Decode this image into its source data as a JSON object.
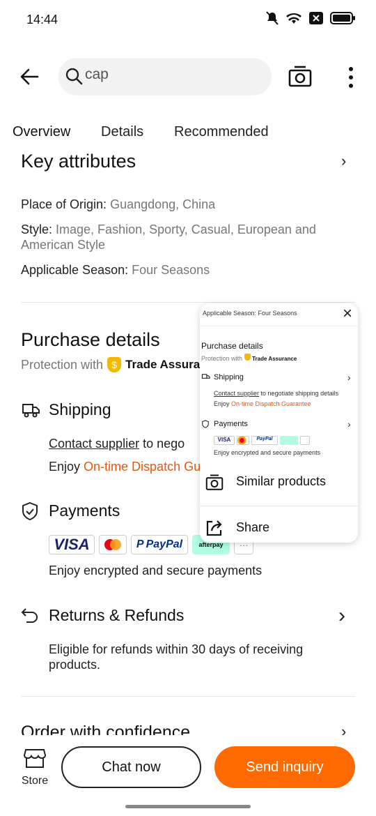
{
  "status": {
    "time": "14:44"
  },
  "search": {
    "value": "cap"
  },
  "tabs": [
    "Overview",
    "Details",
    "Recommended"
  ],
  "key_attributes": {
    "title": "Key attributes",
    "items": [
      {
        "label": "Place of Origin: ",
        "value": "Guangdong, China"
      },
      {
        "label": "Style: ",
        "value": "Image, Fashion, Sporty, Casual, European and American Style"
      },
      {
        "label": "Applicable Season: ",
        "value": "Four Seasons"
      }
    ]
  },
  "purchase": {
    "title": "Purchase details",
    "protection_prefix": "Protection with",
    "trade_assurance": "Trade Assuran"
  },
  "shipping": {
    "title": "Shipping",
    "contact_link": "Contact supplier",
    "contact_rest": " to nego",
    "enjoy_prefix": "Enjoy ",
    "dispatch": "On-time Dispatch Gu"
  },
  "payments": {
    "title": "Payments",
    "methods": [
      "VISA",
      "PayPal",
      "afterpay",
      "···"
    ],
    "note": "Enjoy encrypted and secure payments"
  },
  "returns": {
    "title": "Returns & Refunds",
    "note": "Eligible for refunds within 30 days of receiving products."
  },
  "confidence": {
    "title": "Order with confidence"
  },
  "popup": {
    "mini_season": "Applicable Season: Four Seasons",
    "mini_purchase": "Purchase details",
    "mini_protection": "Protection with",
    "mini_ta": "Trade Assurance",
    "mini_shipping": "Shipping",
    "mini_contact": "Contact supplier",
    "mini_contact_rest": " to negotiate shipping details",
    "mini_enjoy": "Enjoy ",
    "mini_dispatch": "On-time Dispatch Guarantee",
    "mini_payments": "Payments",
    "mini_pay_note": "Enjoy encrypted and secure payments",
    "similar": "Similar products",
    "share": "Share"
  },
  "bottom": {
    "store": "Store",
    "chat": "Chat now",
    "inquiry": "Send inquiry"
  },
  "colors": {
    "accent": "#ff6a00",
    "link_orange": "#e8580c"
  }
}
